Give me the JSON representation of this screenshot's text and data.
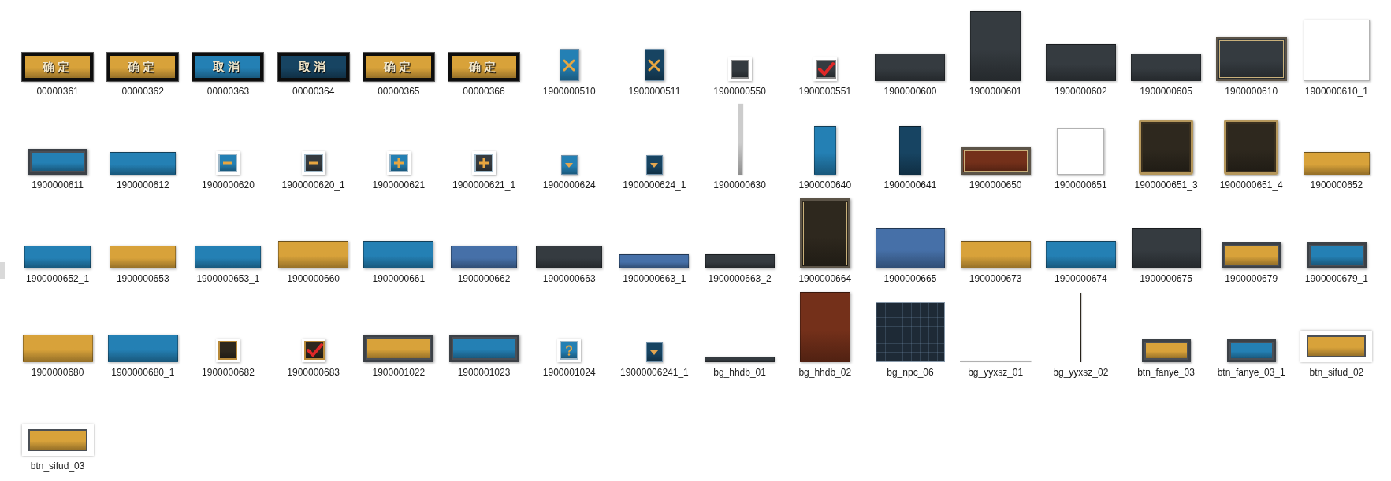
{
  "items": [
    {
      "name": "00000361",
      "kind": "button",
      "color": "#d8a23a",
      "text": "确定"
    },
    {
      "name": "00000362",
      "kind": "button",
      "color": "#d8a23a",
      "text": "确定"
    },
    {
      "name": "00000363",
      "kind": "button",
      "color": "#2480b4",
      "text": "取消"
    },
    {
      "name": "00000364",
      "kind": "button",
      "color": "#174462",
      "text": "取消"
    },
    {
      "name": "00000365",
      "kind": "button",
      "color": "#d8a23a",
      "text": "确定"
    },
    {
      "name": "00000366",
      "kind": "button",
      "color": "#d8a23a",
      "text": "确定"
    },
    {
      "name": "1900000510",
      "kind": "close-tab",
      "color": "#2480b4"
    },
    {
      "name": "1900000511",
      "kind": "close-tab",
      "color": "#174462"
    },
    {
      "name": "1900000550",
      "kind": "checkbox-chip",
      "color": "#353b40",
      "checked": false
    },
    {
      "name": "1900000551",
      "kind": "checkbox-chip",
      "color": "#353b40",
      "checked": true
    },
    {
      "name": "1900000600",
      "kind": "panel-wide",
      "color": "#353b40"
    },
    {
      "name": "1900000601",
      "kind": "panel-portrait",
      "color": "#353b40"
    },
    {
      "name": "1900000602",
      "kind": "panel-banner",
      "color": "#353b40"
    },
    {
      "name": "1900000605",
      "kind": "panel-wide",
      "color": "#353b40"
    },
    {
      "name": "1900000610",
      "kind": "frame-frame",
      "color": "#353b40"
    },
    {
      "name": "1900000610_1",
      "kind": "panel-blank",
      "color": "#ffffff"
    },
    {
      "name": "1900000611",
      "kind": "plate-medium",
      "color": "#2480b4"
    },
    {
      "name": "1900000612",
      "kind": "panel-low",
      "color": "#2480b4"
    },
    {
      "name": "1900000620",
      "kind": "minus-chip",
      "color": "#2480b4"
    },
    {
      "name": "1900000620_1",
      "kind": "minus-chip",
      "color": "#353b40"
    },
    {
      "name": "1900000621",
      "kind": "plus-chip",
      "color": "#2480b4"
    },
    {
      "name": "1900000621_1",
      "kind": "plus-chip",
      "color": "#353b40"
    },
    {
      "name": "1900000624",
      "kind": "arrow-nub",
      "color": "#2480b4"
    },
    {
      "name": "1900000624_1",
      "kind": "arrow-nub",
      "color": "#174462"
    },
    {
      "name": "1900000630",
      "kind": "line-rod",
      "color": "#cccccc"
    },
    {
      "name": "1900000640",
      "kind": "panel-tall",
      "color": "#2480b4"
    },
    {
      "name": "1900000641",
      "kind": "panel-tall",
      "color": "#174462"
    },
    {
      "name": "1900000650",
      "kind": "frame-wide",
      "color": "#74301a"
    },
    {
      "name": "1900000651",
      "kind": "panel-square",
      "color": "#ffffff"
    },
    {
      "name": "1900000651_3",
      "kind": "frame-ornate",
      "color": "#2e281e"
    },
    {
      "name": "1900000651_4",
      "kind": "frame-ornate",
      "color": "#2e281e"
    },
    {
      "name": "1900000652",
      "kind": "panel-low",
      "color": "#d8a23a"
    },
    {
      "name": "1900000652_1",
      "kind": "panel-low",
      "color": "#2480b4"
    },
    {
      "name": "1900000653",
      "kind": "panel-low",
      "color": "#d8a23a"
    },
    {
      "name": "1900000653_1",
      "kind": "panel-low",
      "color": "#2480b4"
    },
    {
      "name": "1900000660",
      "kind": "panel-wide",
      "color": "#d8a23a"
    },
    {
      "name": "1900000661",
      "kind": "panel-wide",
      "color": "#2480b4"
    },
    {
      "name": "1900000662",
      "kind": "panel-low",
      "color": "#4670a8"
    },
    {
      "name": "1900000663",
      "kind": "panel-low",
      "color": "#353b40"
    },
    {
      "name": "1900000663_1",
      "kind": "panel-slim",
      "color": "#4670a8"
    },
    {
      "name": "1900000663_2",
      "kind": "panel-slim",
      "color": "#353b40"
    },
    {
      "name": "1900000664",
      "kind": "frame-portrait",
      "color": "#2e281e"
    },
    {
      "name": "1900000665",
      "kind": "panel-deep",
      "color": "#4670a8"
    },
    {
      "name": "1900000673",
      "kind": "panel-wide",
      "color": "#d8a23a"
    },
    {
      "name": "1900000674",
      "kind": "panel-wide",
      "color": "#2480b4"
    },
    {
      "name": "1900000675",
      "kind": "panel-deep",
      "color": "#353b40"
    },
    {
      "name": "1900000679",
      "kind": "plate-medium",
      "color": "#d8a23a"
    },
    {
      "name": "1900000679_1",
      "kind": "plate-medium",
      "color": "#2480b4"
    },
    {
      "name": "1900000680",
      "kind": "panel-wide",
      "color": "#d8a23a"
    },
    {
      "name": "1900000680_1",
      "kind": "panel-wide",
      "color": "#2480b4"
    },
    {
      "name": "1900000682",
      "kind": "checkbox-gilt",
      "color": "#2e281e",
      "checked": false
    },
    {
      "name": "1900000683",
      "kind": "checkbox-gilt",
      "color": "#2e281e",
      "checked": true
    },
    {
      "name": "1900001022",
      "kind": "plate-wide",
      "color": "#d8a23a"
    },
    {
      "name": "1900001023",
      "kind": "plate-wide",
      "color": "#2480b4"
    },
    {
      "name": "1900001024",
      "kind": "help-chip",
      "color": "#2480b4"
    },
    {
      "name": "19000006241_1",
      "kind": "arrow-nub",
      "color": "#174462"
    },
    {
      "name": "bg_hhdb_01",
      "kind": "panel-strip",
      "color": "#353b40"
    },
    {
      "name": "bg_hhdb_02",
      "kind": "panel-portrait",
      "color": "#74301a"
    },
    {
      "name": "bg_npc_06",
      "kind": "grid-board",
      "color": "#1e2a36"
    },
    {
      "name": "bg_yyxsz_01",
      "kind": "line-hairline",
      "color": "#cccccc"
    },
    {
      "name": "bg_yyxsz_02",
      "kind": "line-thread",
      "color": "#2e281e"
    },
    {
      "name": "btn_fanye_03",
      "kind": "plate-short",
      "color": "#d8a23a"
    },
    {
      "name": "btn_fanye_03_1",
      "kind": "plate-short",
      "color": "#2480b4"
    },
    {
      "name": "btn_sifud_02",
      "kind": "plate-framed",
      "color": "#d8a23a"
    },
    {
      "name": "btn_sifud_03",
      "kind": "plate-framed",
      "color": "#d8a23a"
    }
  ]
}
